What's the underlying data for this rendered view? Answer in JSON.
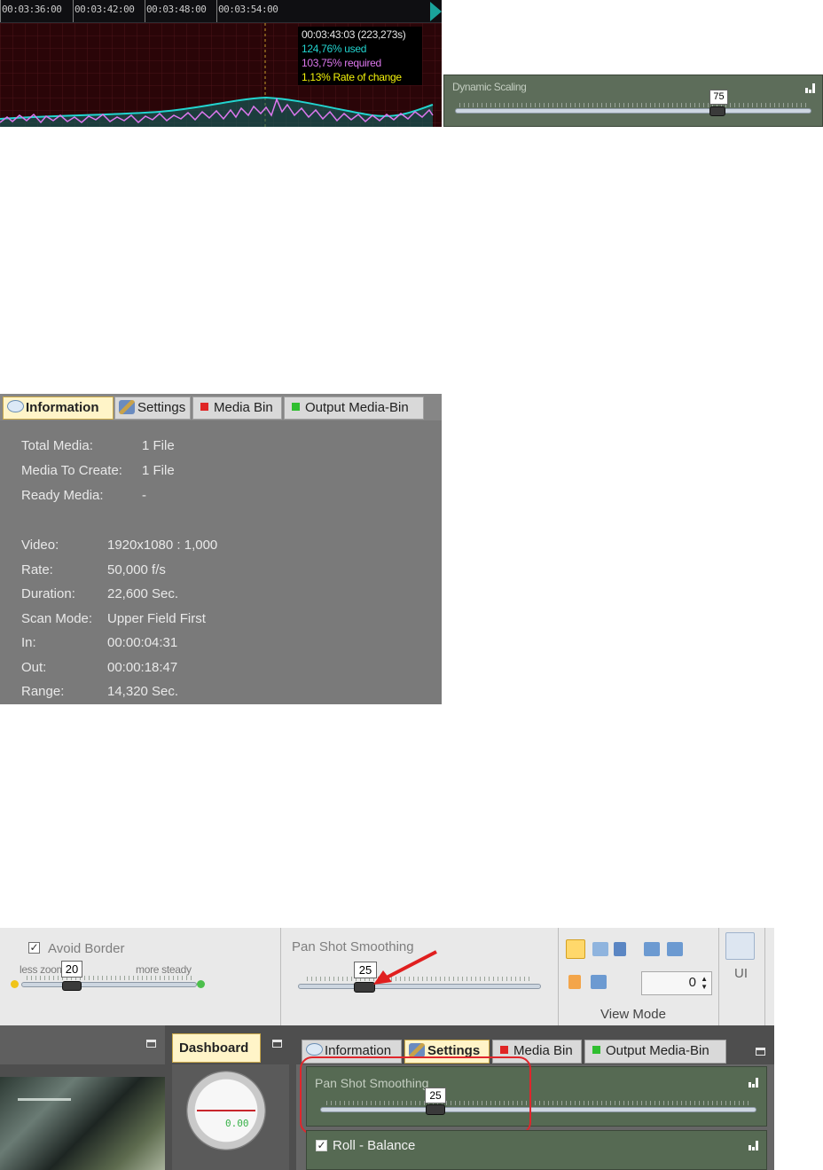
{
  "timeline": {
    "ticks": [
      "00:03:36:00",
      "00:03:42:00",
      "00:03:48:00",
      "00:03:54:00"
    ],
    "tooltip": {
      "time": "00:03:43:03 (223,273s)",
      "used": "124,76% used",
      "required": "103,75% required",
      "rate": "1,13% Rate of change"
    },
    "colors": {
      "used": "#22d4cf",
      "required": "#dd77ee",
      "rate": "#f2f20a"
    }
  },
  "dynamic_scaling": {
    "title": "Dynamic Scaling",
    "value": "75",
    "slider_level": 0.72
  },
  "info_panel": {
    "tabs": [
      {
        "label": "Information",
        "icon": "speech-bubble-icon"
      },
      {
        "label": "Settings",
        "icon": "tools-icon"
      },
      {
        "label": "Media Bin",
        "icon": "red-square-icon"
      },
      {
        "label": "Output Media-Bin",
        "icon": "green-square-icon"
      }
    ],
    "summary": [
      {
        "label": "Total Media:",
        "value": "1 File"
      },
      {
        "label": "Media To Create:",
        "value": "1 File"
      },
      {
        "label": "Ready Media:",
        "value": "-"
      }
    ],
    "details": [
      {
        "label": "Video:",
        "value": "1920x1080 : 1,000"
      },
      {
        "label": "Rate:",
        "value": "50,000 f/s"
      },
      {
        "label": "Duration:",
        "value": "22,600 Sec."
      },
      {
        "label": "Scan Mode:",
        "value": "Upper Field First"
      },
      {
        "label": "In:",
        "value": "00:00:04:31"
      },
      {
        "label": "Out:",
        "value": "00:00:18:47"
      },
      {
        "label": "Range:",
        "value": "14,320 Sec."
      }
    ]
  },
  "toolbar": {
    "avoid_border": {
      "label": "Avoid Border",
      "checked": true,
      "value": "20",
      "left_label": "less zoom",
      "right_label": "more steady"
    },
    "pan_shot": {
      "title": "Pan Shot Smoothing",
      "value": "25"
    },
    "spin_value": "0",
    "view_mode_label": "View Mode",
    "ui_label": "UI"
  },
  "lower": {
    "dashboard_tab": "Dashboard",
    "gauge_readout": "0.00",
    "tabs": [
      "Information",
      "Settings",
      "Media Bin",
      "Output Media-Bin"
    ],
    "pan_shot_panel": {
      "title": "Pan Shot Smoothing",
      "value": "25"
    },
    "roll_balance": {
      "label": "Roll - Balance",
      "checked": true
    }
  }
}
